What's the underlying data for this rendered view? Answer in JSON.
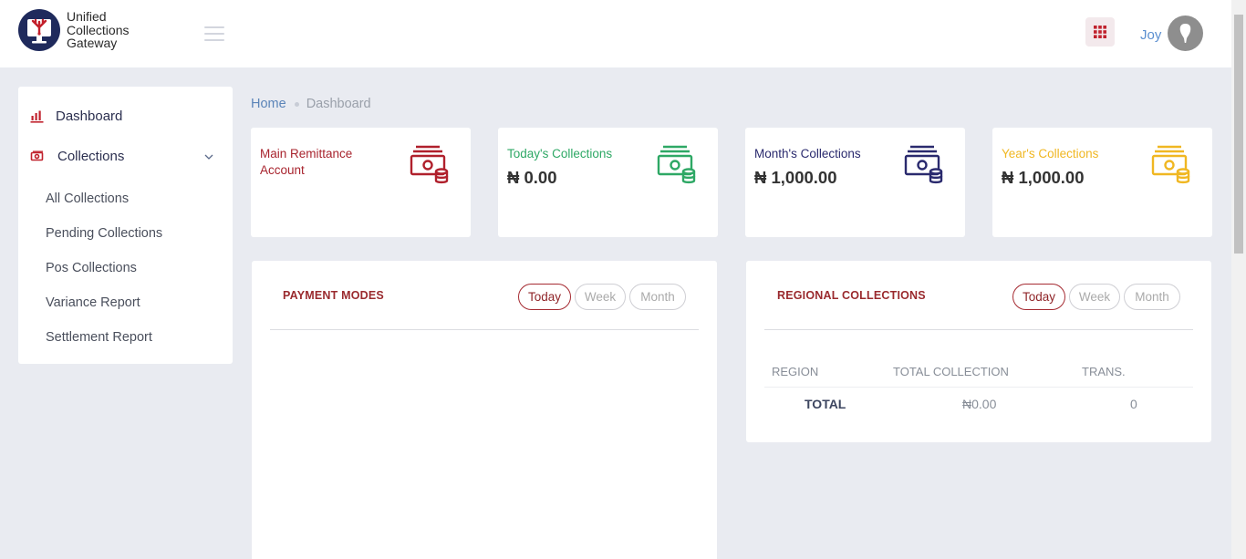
{
  "header": {
    "brand": {
      "line1": "Unified",
      "line2": "Collections",
      "line3": "Gateway"
    },
    "username": "Joy"
  },
  "sidebar": {
    "dashboard_label": "Dashboard",
    "collections_label": "Collections",
    "sub_items": [
      "All Collections",
      "Pending Collections",
      "Pos Collections",
      "Variance Report",
      "Settlement Report"
    ]
  },
  "breadcrumb": {
    "home": "Home",
    "current": "Dashboard"
  },
  "cards": [
    {
      "title": "Main Remittance Account",
      "value": "",
      "color": "#b0202c"
    },
    {
      "title": "Today's Collections",
      "value": "₦ 0.00",
      "color": "#2ea865"
    },
    {
      "title": "Month's Collections",
      "value": "₦ 1,000.00",
      "color": "#2a2a6e"
    },
    {
      "title": "Year's Collections",
      "value": "₦ 1,000.00",
      "color": "#f0b722"
    }
  ],
  "payment_modes": {
    "title": "PAYMENT MODES",
    "filters": [
      "Today",
      "Week",
      "Month"
    ],
    "active_filter": "Today"
  },
  "regional_collections": {
    "title": "REGIONAL COLLECTIONS",
    "filters": [
      "Today",
      "Week",
      "Month"
    ],
    "active_filter": "Today",
    "columns": [
      "REGION",
      "TOTAL COLLECTION",
      "TRANS."
    ],
    "total_row": {
      "label": "TOTAL",
      "amount": "₦0.00",
      "count": "0"
    }
  },
  "colors": {
    "accent": "#9a2a2e",
    "link": "#5b84b8",
    "background": "#e9ebf1"
  }
}
